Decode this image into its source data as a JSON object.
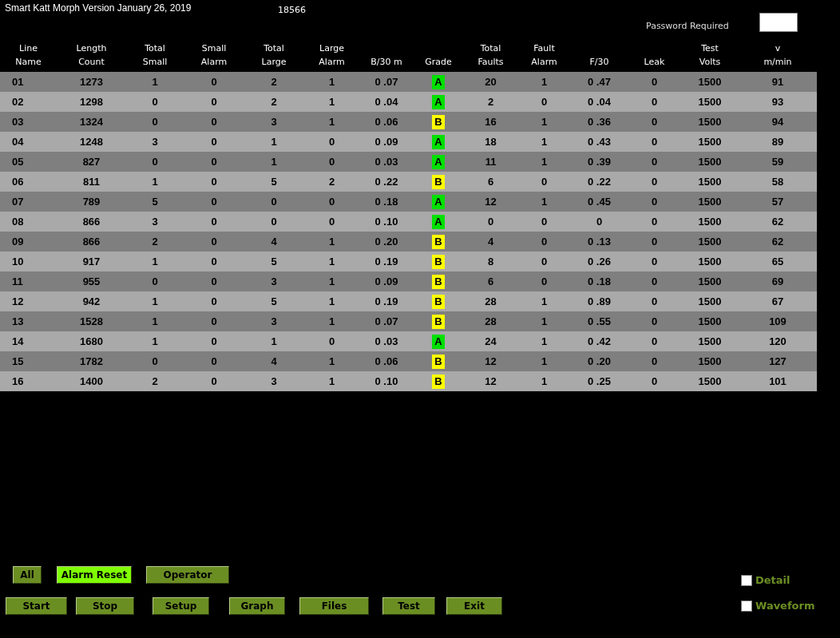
{
  "title": "Smart Katt Morph Version January 26, 2019",
  "counter": "18566",
  "password": {
    "label": "Password Required"
  },
  "columns": [
    {
      "line1": "Line",
      "line2": "Name"
    },
    {
      "line1": "Length",
      "line2": "Count"
    },
    {
      "line1": "Total",
      "line2": "Small"
    },
    {
      "line1": "Small",
      "line2": "Alarm"
    },
    {
      "line1": "Total",
      "line2": "Large"
    },
    {
      "line1": "Large",
      "line2": "Alarm"
    },
    {
      "line2": "B/30 m"
    },
    {
      "line2": "Grade"
    },
    {
      "line1": "Total",
      "line2": "Faults"
    },
    {
      "line1": "Fault",
      "line2": "Alarm"
    },
    {
      "line2": "F/30"
    },
    {
      "line2": "Leak"
    },
    {
      "line1": "Test",
      "line2": "Volts"
    },
    {
      "line1": "v",
      "line2": "m/min"
    }
  ],
  "rows": [
    {
      "cells": [
        "01",
        "1273",
        "1",
        "0",
        "2",
        "1",
        "0 .07",
        "A",
        "20",
        "1",
        "0 .47",
        "0",
        "1500",
        "91"
      ],
      "color": "#00e000"
    },
    {
      "cells": [
        "02",
        "1298",
        "0",
        "0",
        "2",
        "1",
        "0 .04",
        "A",
        "2",
        "0",
        "0 .04",
        "0",
        "1500",
        "93"
      ],
      "color": "#00e000"
    },
    {
      "cells": [
        "03",
        "1324",
        "0",
        "0",
        "3",
        "1",
        "0 .06",
        "B",
        "16",
        "1",
        "0 .36",
        "0",
        "1500",
        "94"
      ],
      "color": "#ffff00"
    },
    {
      "cells": [
        "04",
        "1248",
        "3",
        "0",
        "1",
        "0",
        "0 .09",
        "A",
        "18",
        "1",
        "0 .43",
        "0",
        "1500",
        "89"
      ],
      "color": "#00e000"
    },
    {
      "cells": [
        "05",
        "827",
        "0",
        "0",
        "1",
        "0",
        "0 .03",
        "A",
        "11",
        "1",
        "0 .39",
        "0",
        "1500",
        "59"
      ],
      "color": "#00e000"
    },
    {
      "cells": [
        "06",
        "811",
        "1",
        "0",
        "5",
        "2",
        "0 .22",
        "B",
        "6",
        "0",
        "0 .22",
        "0",
        "1500",
        "58"
      ],
      "color": "#ffff00"
    },
    {
      "cells": [
        "07",
        "789",
        "5",
        "0",
        "0",
        "0",
        "0 .18",
        "A",
        "12",
        "1",
        "0 .45",
        "0",
        "1500",
        "57"
      ],
      "color": "#00e000"
    },
    {
      "cells": [
        "08",
        "866",
        "3",
        "0",
        "0",
        "0",
        "0 .10",
        "A",
        "0",
        "0",
        "0",
        "0",
        "1500",
        "62"
      ],
      "color": "#00e000"
    },
    {
      "cells": [
        "09",
        "866",
        "2",
        "0",
        "4",
        "1",
        "0 .20",
        "B",
        "4",
        "0",
        "0 .13",
        "0",
        "1500",
        "62"
      ],
      "color": "#ffff00"
    },
    {
      "cells": [
        "10",
        "917",
        "1",
        "0",
        "5",
        "1",
        "0 .19",
        "B",
        "8",
        "0",
        "0 .26",
        "0",
        "1500",
        "65"
      ],
      "color": "#ffff00"
    },
    {
      "cells": [
        "11",
        "955",
        "0",
        "0",
        "3",
        "1",
        "0 .09",
        "B",
        "6",
        "0",
        "0 .18",
        "0",
        "1500",
        "69"
      ],
      "color": "#ffff00"
    },
    {
      "cells": [
        "12",
        "942",
        "1",
        "0",
        "5",
        "1",
        "0 .19",
        "B",
        "28",
        "1",
        "0 .89",
        "0",
        "1500",
        "67"
      ],
      "color": "#ffff00"
    },
    {
      "cells": [
        "13",
        "1528",
        "1",
        "0",
        "3",
        "1",
        "0 .07",
        "B",
        "28",
        "1",
        "0 .55",
        "0",
        "1500",
        "109"
      ],
      "color": "#ffff00"
    },
    {
      "cells": [
        "14",
        "1680",
        "1",
        "0",
        "1",
        "0",
        "0 .03",
        "A",
        "24",
        "1",
        "0 .42",
        "0",
        "1500",
        "120"
      ],
      "color": "#00e000"
    },
    {
      "cells": [
        "15",
        "1782",
        "0",
        "0",
        "4",
        "1",
        "0 .06",
        "B",
        "12",
        "1",
        "0 .20",
        "0",
        "1500",
        "127"
      ],
      "color": "#ffff00"
    },
    {
      "cells": [
        "16",
        "1400",
        "2",
        "0",
        "3",
        "1",
        "0 .10",
        "B",
        "12",
        "1",
        "0 .25",
        "0",
        "1500",
        "101"
      ],
      "color": "#ffff00"
    }
  ],
  "buttons_top": [
    {
      "label": "All",
      "active": false
    },
    {
      "label": "Alarm Reset",
      "active": true
    },
    {
      "label": "Operator",
      "active": false
    }
  ],
  "buttons_bottom": [
    {
      "label": "Start"
    },
    {
      "label": "Stop"
    },
    {
      "label": "Setup"
    },
    {
      "label": "Graph"
    },
    {
      "label": "Files"
    },
    {
      "label": "Test"
    },
    {
      "label": "Exit"
    }
  ],
  "options": [
    {
      "label": "Detail",
      "checked": false
    },
    {
      "label": "Waveform",
      "checked": false
    }
  ]
}
